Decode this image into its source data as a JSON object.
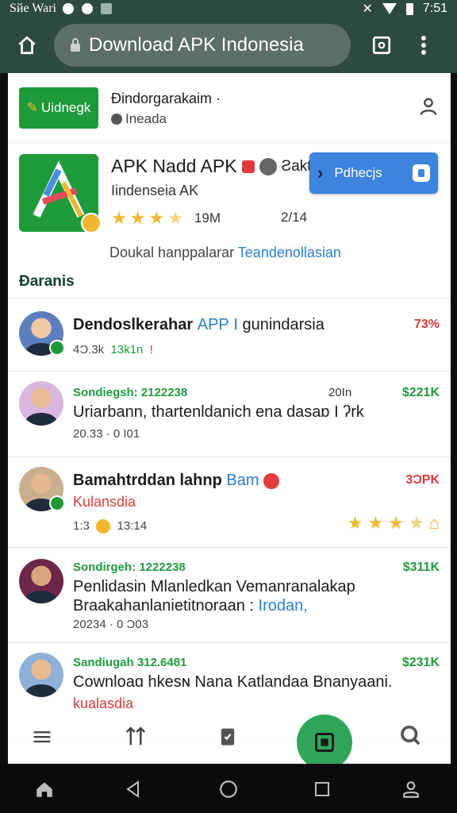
{
  "status_bar": {
    "carrier": "Sйe Wari",
    "time": "7:51"
  },
  "browser": {
    "url_title": "Download APK Indonesia"
  },
  "site": {
    "logo_text": "Uidnegk",
    "name": "Ðindorgarakaim",
    "name_suffix": "·",
    "subtitle": "Ineada"
  },
  "app": {
    "title": "APK Nadd APK",
    "title_tail": "Ƨakt",
    "developer": "Iindenseia  AK",
    "size": "19M",
    "version": "2/14",
    "download_label": "Pdhecjs",
    "description": "Doukal hanppalarar",
    "description_link": "Teandenollasian",
    "rating": 3.5
  },
  "section_title": "Ðaranis",
  "items": [
    {
      "title": "Dendoslkerahar",
      "title_blue": "APP",
      "title_sep": "I",
      "title_tail": "gunindarsia",
      "meta_left": "4Ɔ.3k",
      "meta_green": "13k1n",
      "meta_mark": "ǃ",
      "price": "73%",
      "price_dir": "up"
    },
    {
      "tag": "Sondiegsh: 2122238",
      "date": "20In",
      "text": "Uriarbann, thartenldanich ena dasaɒ I ʔrk",
      "meta": "20.33 · 0 I01",
      "price": "$221K",
      "price_dir": "dn"
    },
    {
      "title": "Bamahtrddan lahnp",
      "title_blue": "Bam",
      "subtitle": "Kulansdia",
      "meta_left": "1:3",
      "meta_right": "13:14",
      "price": "3ƆPK",
      "price_dir": "up",
      "rating": 4
    },
    {
      "tag": "Sondirgeh: 1222238",
      "text": "Penlidasin Mlanledkan Vemanranalakap",
      "text2": "Braakahanlanietitnoraan :",
      "text2_link": "Irodan,",
      "meta": "20234 · 0 Ɔ03",
      "price": "$311K",
      "price_dir": "dn"
    },
    {
      "tag": "Sandiugah  312.6481",
      "text": "Cownloaɑ hkesɴ Nana Katlandaa Bnanyaani.",
      "subtitle": "kualasdia",
      "price": "$231K",
      "price_dir": "dn"
    }
  ]
}
